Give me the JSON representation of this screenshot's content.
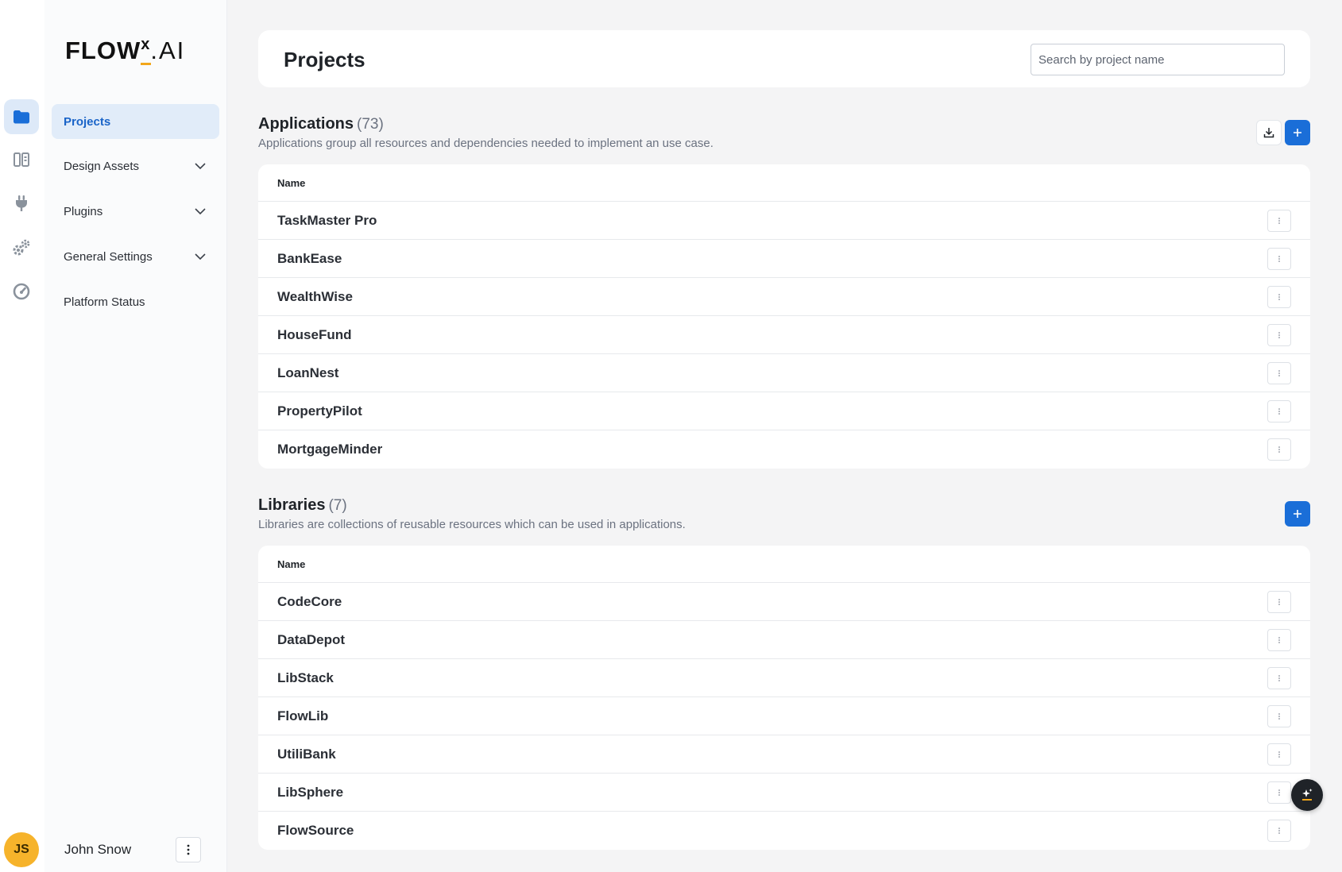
{
  "brand": {
    "logo_text": "FLOW",
    "logo_x": "x",
    "logo_ai": ".AI",
    "accent": "#f2a71b"
  },
  "rail": {
    "items": [
      {
        "icon": "folder-icon",
        "active": true
      },
      {
        "icon": "library-icon",
        "active": false
      },
      {
        "icon": "plug-icon",
        "active": false
      },
      {
        "icon": "gears-icon",
        "active": false
      },
      {
        "icon": "gauge-icon",
        "active": false
      }
    ]
  },
  "nav": {
    "items": [
      {
        "label": "Projects",
        "active": true,
        "expandable": false
      },
      {
        "label": "Design Assets",
        "active": false,
        "expandable": true
      },
      {
        "label": "Plugins",
        "active": false,
        "expandable": true
      },
      {
        "label": "General Settings",
        "active": false,
        "expandable": true
      },
      {
        "label": "Platform Status",
        "active": false,
        "expandable": false
      }
    ]
  },
  "user": {
    "initials": "JS",
    "name": "John Snow"
  },
  "header": {
    "title": "Projects",
    "search_placeholder": "Search by project name",
    "search_value": ""
  },
  "applications": {
    "title": "Applications",
    "count": "(73)",
    "description": "Applications group all resources and dependencies needed to implement an use case.",
    "column": "Name",
    "rows": [
      "TaskMaster Pro",
      "BankEase",
      "WealthWise",
      "HouseFund",
      "LoanNest",
      "PropertyPilot",
      "MortgageMinder"
    ]
  },
  "libraries": {
    "title": "Libraries",
    "count": "(7)",
    "description": "Libraries are collections of reusable resources which can be used in applications.",
    "column": "Name",
    "rows": [
      "CodeCore",
      "DataDepot",
      "LibStack",
      "FlowLib",
      "UtiliBank",
      "LibSphere",
      "FlowSource"
    ]
  },
  "colors": {
    "primary": "#1a6ed8",
    "active_bg": "#e1ecf9",
    "avatar": "#f6b32b"
  }
}
